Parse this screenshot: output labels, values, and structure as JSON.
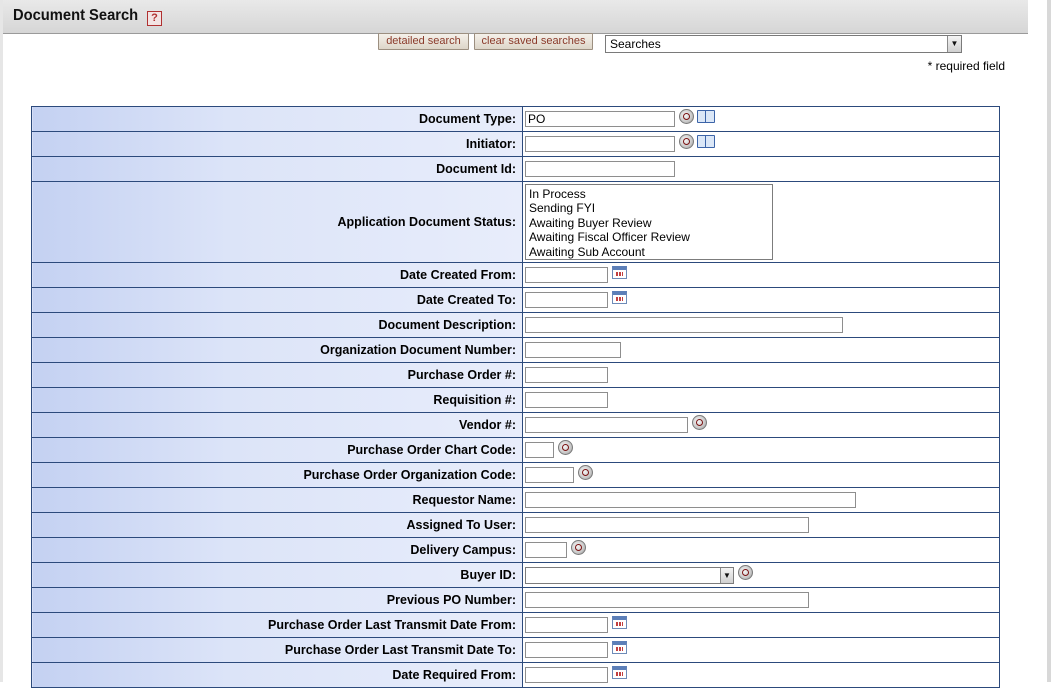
{
  "header": {
    "title": "Document Search",
    "help_glyph": "?"
  },
  "toolbar": {
    "detailed_search_label": "detailed search",
    "clear_saved_searches_label": "clear saved searches",
    "searches_select_value": "Searches"
  },
  "required_note": "* required field",
  "form": {
    "document_type": {
      "label": "Document Type:",
      "value": "PO"
    },
    "initiator": {
      "label": "Initiator:",
      "value": ""
    },
    "document_id": {
      "label": "Document Id:",
      "value": ""
    },
    "app_doc_status": {
      "label": "Application Document Status:",
      "options": [
        "In Process",
        "Sending FYI",
        "Awaiting Buyer Review",
        "Awaiting Fiscal Officer Review",
        "Awaiting Sub Account"
      ]
    },
    "date_created_from": {
      "label": "Date Created From:"
    },
    "date_created_to": {
      "label": "Date Created To:"
    },
    "document_description": {
      "label": "Document Description:"
    },
    "org_document_number": {
      "label": "Organization Document Number:"
    },
    "purchase_order_number": {
      "label": "Purchase Order #:"
    },
    "requisition_number": {
      "label": "Requisition #:"
    },
    "vendor_number": {
      "label": "Vendor #:"
    },
    "po_chart_code": {
      "label": "Purchase Order Chart Code:"
    },
    "po_org_code": {
      "label": "Purchase Order Organization Code:"
    },
    "requestor_name": {
      "label": "Requestor Name:"
    },
    "assigned_to_user": {
      "label": "Assigned To User:"
    },
    "delivery_campus": {
      "label": "Delivery Campus:"
    },
    "buyer_id": {
      "label": "Buyer ID:",
      "value": ""
    },
    "previous_po_number": {
      "label": "Previous PO Number:"
    },
    "po_last_transmit_from": {
      "label": "Purchase Order Last Transmit Date From:"
    },
    "po_last_transmit_to": {
      "label": "Purchase Order Last Transmit Date To:"
    },
    "date_required_from": {
      "label": "Date Required From:"
    }
  },
  "colors": {
    "label_bg": "#c4d1f2",
    "border": "#2c4a7c",
    "button_text": "#8a3a2a"
  }
}
